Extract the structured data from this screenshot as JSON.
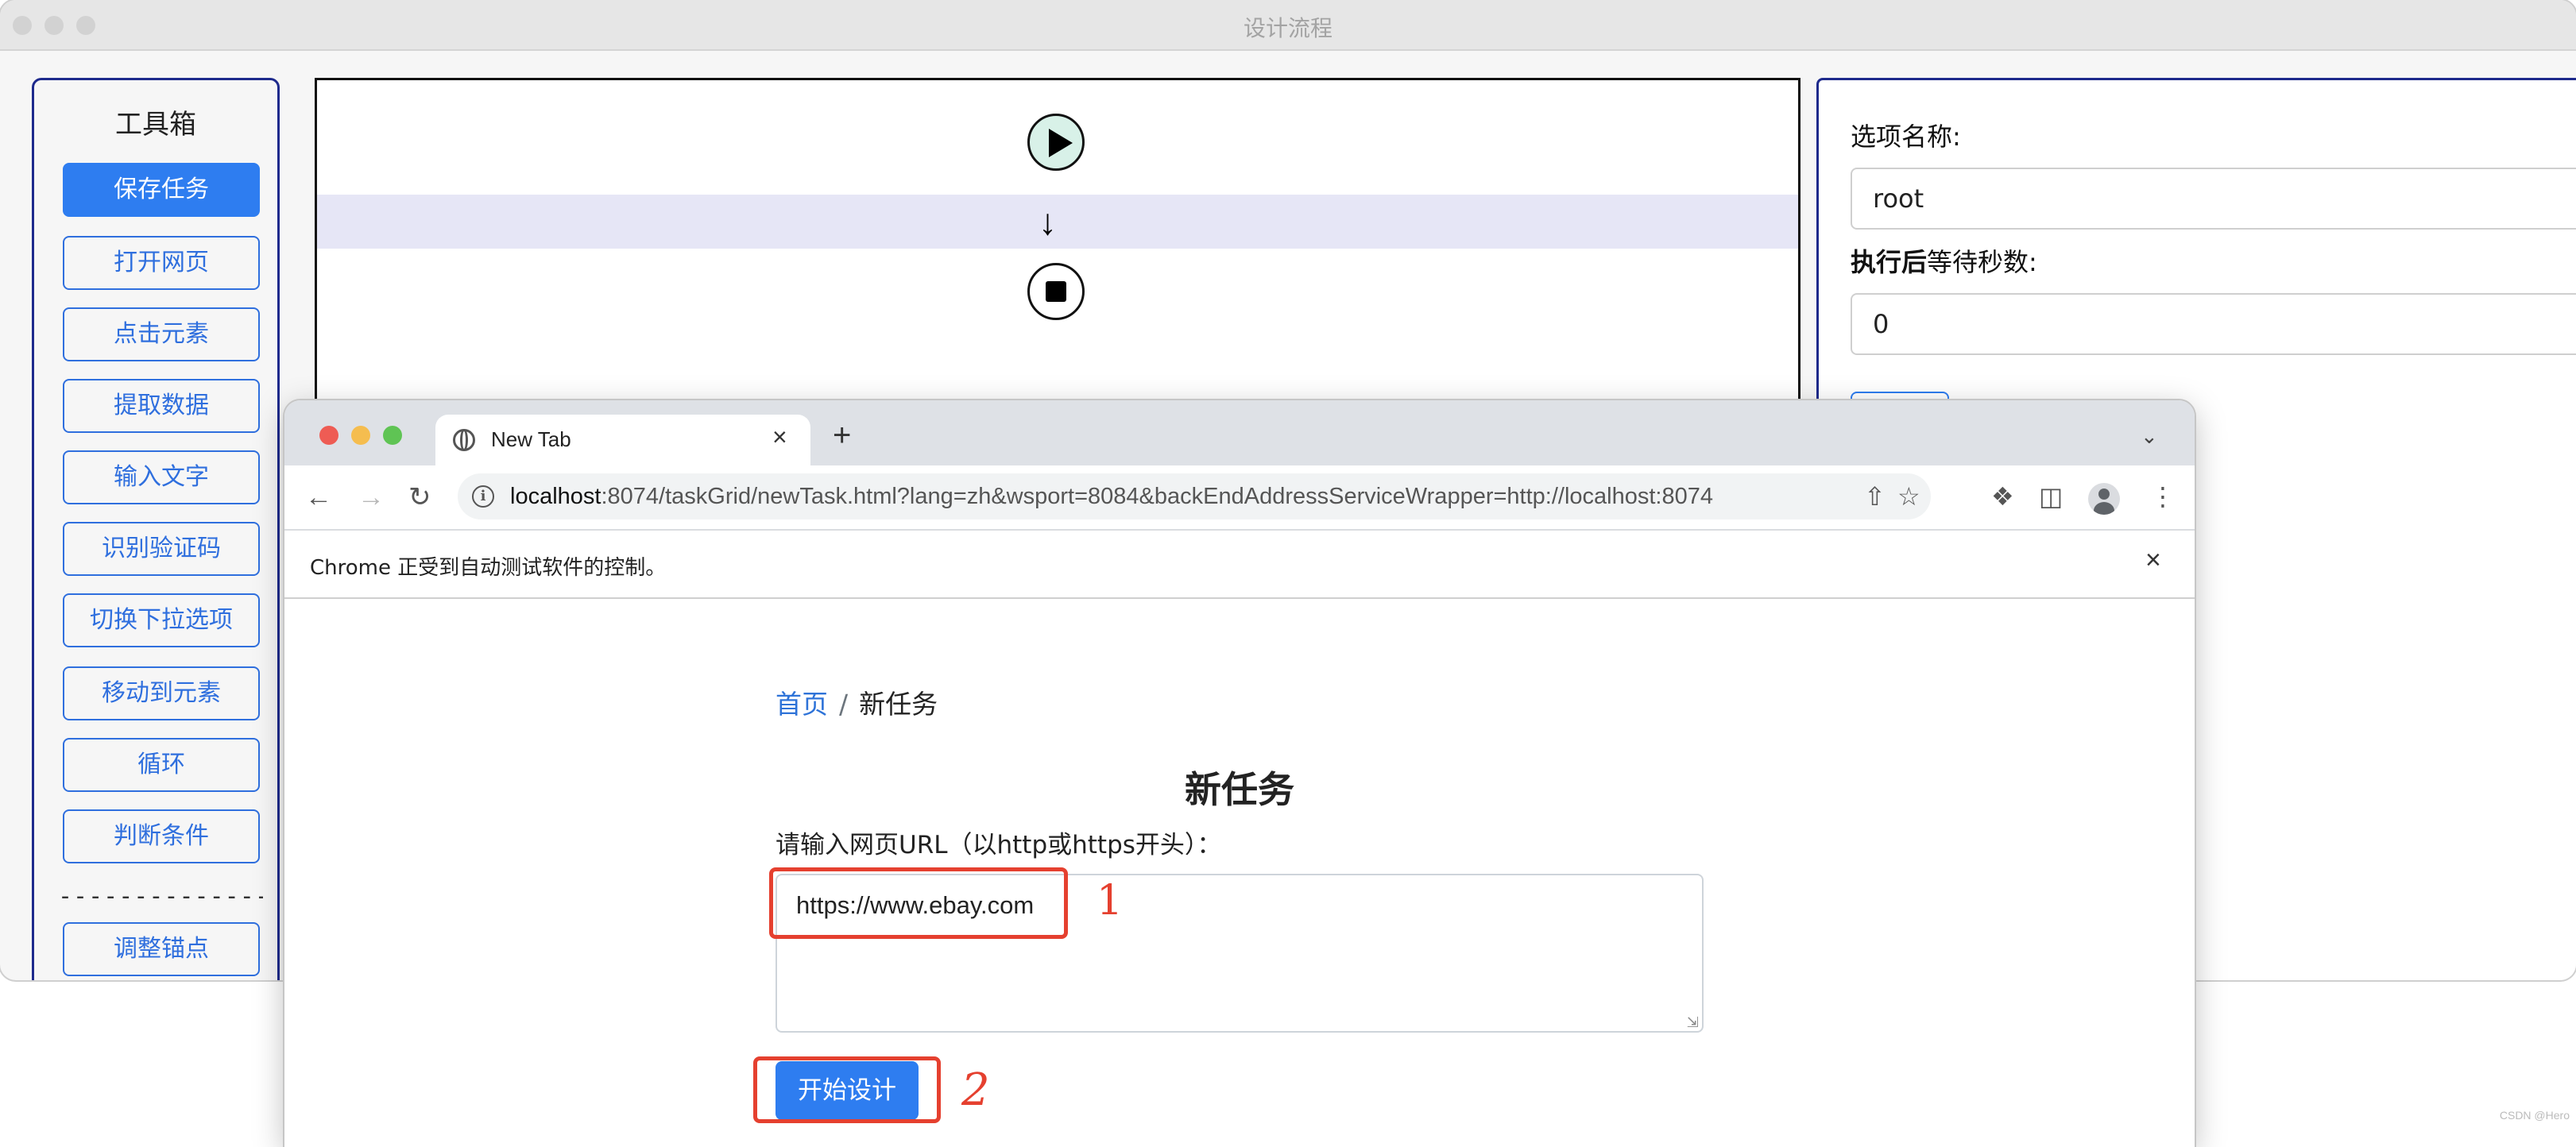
{
  "back_window": {
    "title": "设计流程",
    "toolbox": {
      "title": "工具箱",
      "buttons": [
        "保存任务",
        "打开网页",
        "点击元素",
        "提取数据",
        "输入文字",
        "识别验证码",
        "切换下拉选项",
        "移动到元素",
        "循环",
        "判断条件"
      ],
      "divider": "-----------------",
      "extra_button": "调整锚点"
    },
    "flow": {
      "arrow": "↓"
    },
    "properties": {
      "option_name_label": "选项名称:",
      "option_name_value": "root",
      "wait_label_bold": "执行后",
      "wait_label_rest": "等待秒数:",
      "wait_value": "0"
    }
  },
  "browser": {
    "tab_title": "New Tab",
    "tab_close": "×",
    "new_tab": "+",
    "url_host": "localhost",
    "url_rest": ":8074/taskGrid/newTask.html?lang=zh&wsport=8084&backEndAddressServiceWrapper=http://localhost:8074",
    "infobar_text": "Chrome 正受到自动测试软件的控制。",
    "infobar_close": "×"
  },
  "page": {
    "breadcrumb": {
      "home": "首页",
      "separator": "/",
      "current": "新任务"
    },
    "heading": "新任务",
    "url_label": "请输入网页URL（以http或https开头）：",
    "url_value": "https://www.ebay.com",
    "start_button": "开始设计"
  },
  "annotations": {
    "mark_1": "1",
    "mark_2": "2"
  },
  "colors": {
    "primary": "#2e7df0",
    "annotation": "#e5402f",
    "panel_border": "#1e2a8c"
  },
  "watermark": "CSDN @Hero"
}
